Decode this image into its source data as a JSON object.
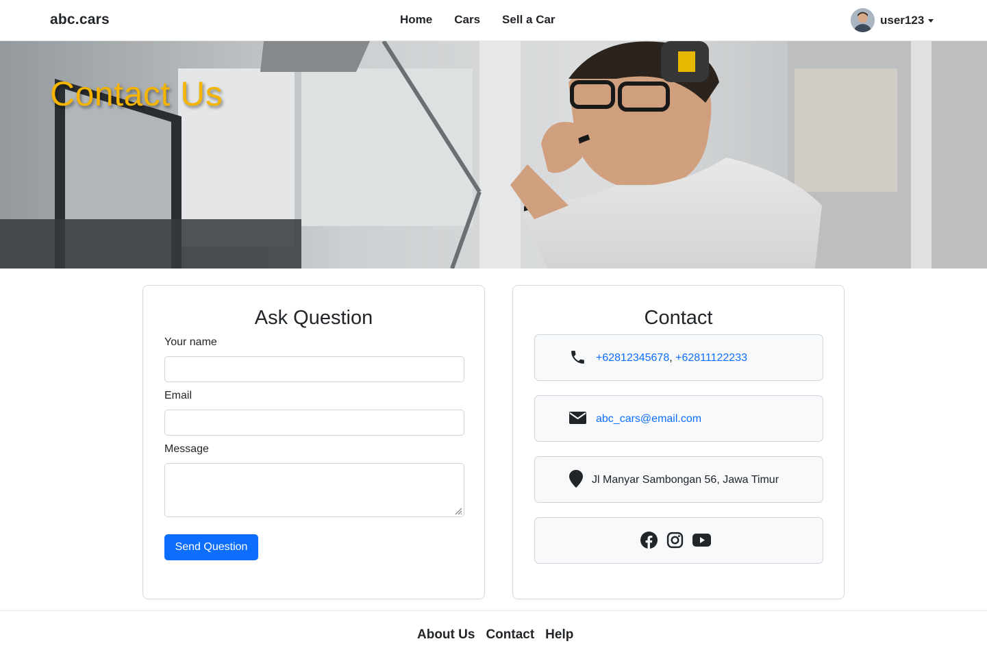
{
  "navbar": {
    "brand": "abc.cars",
    "links": [
      "Home",
      "Cars",
      "Sell a Car"
    ],
    "user": "user123"
  },
  "hero": {
    "title": "Contact Us",
    "title_color": "#f4b400"
  },
  "ask_form": {
    "title": "Ask Question",
    "name_label": "Your name",
    "name_value": "",
    "email_label": "Email",
    "email_value": "",
    "message_label": "Message",
    "message_value": "",
    "submit_label": "Send Question",
    "submit_color": "#0d6efd"
  },
  "contact": {
    "title": "Contact",
    "phone_icon": "phone-icon",
    "phone_1": "+62812345678",
    "phone_separator": ",",
    "phone_2": "+62811122233",
    "email_icon": "envelope-icon",
    "email": "abc_cars@email.com",
    "address_icon": "map-pin-icon",
    "address": "Jl Manyar Sambongan 56, Jawa Timur",
    "social_icons": [
      "facebook-icon",
      "instagram-icon",
      "youtube-icon"
    ],
    "link_color": "#0d6efd"
  },
  "footer": {
    "links": [
      "About Us",
      "Contact",
      "Help"
    ]
  }
}
